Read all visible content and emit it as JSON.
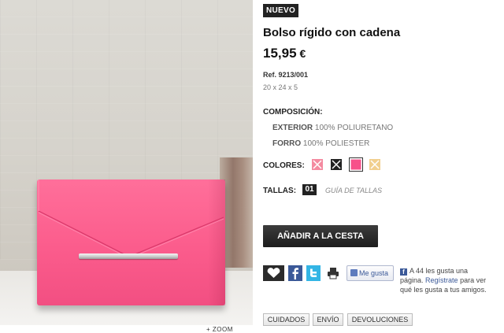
{
  "product": {
    "badge": "NUEVO",
    "title": "Bolso rígido con cadena",
    "price_main": "15,95",
    "currency": "€",
    "ref": "Ref. 9213/001",
    "dimensions": "20 x 24 x 5"
  },
  "image": {
    "zoom_label": "+ ZOOM"
  },
  "composition": {
    "label": "COMPOSICIÓN:",
    "exterior_label": "EXTERIOR",
    "exterior_value": "100% POLIURETANO",
    "lining_label": "FORRO",
    "lining_value": "100% POLIESTER"
  },
  "colors": {
    "label": "COLORES:",
    "swatches": [
      {
        "name": "pink-light",
        "color": "#f48aa0",
        "crossed": true,
        "selected": false
      },
      {
        "name": "black",
        "color": "#222222",
        "crossed": true,
        "selected": false
      },
      {
        "name": "fuchsia",
        "color": "#f7518a",
        "crossed": false,
        "selected": true
      },
      {
        "name": "beige",
        "color": "#f1cf8e",
        "crossed": true,
        "selected": false
      }
    ]
  },
  "sizes": {
    "label": "TALLAS:",
    "selected": "01",
    "guide_link": "GUÍA DE TALLAS"
  },
  "cart_button": "AÑADIR A LA CESTA",
  "social": {
    "like_button": "Me gusta",
    "fb_prefix": "A 44 les gusta una página.",
    "fb_link": "Regístrate",
    "fb_suffix": "para ver qué les gusta a tus amigos."
  },
  "tabs": [
    "CUIDADOS",
    "ENVÍO",
    "DEVOLUCIONES"
  ],
  "accent_colors": {
    "bag_pink": "#fb5c8c",
    "facebook": "#3b5998",
    "twitter": "#33b5e5",
    "dark": "#222222"
  }
}
